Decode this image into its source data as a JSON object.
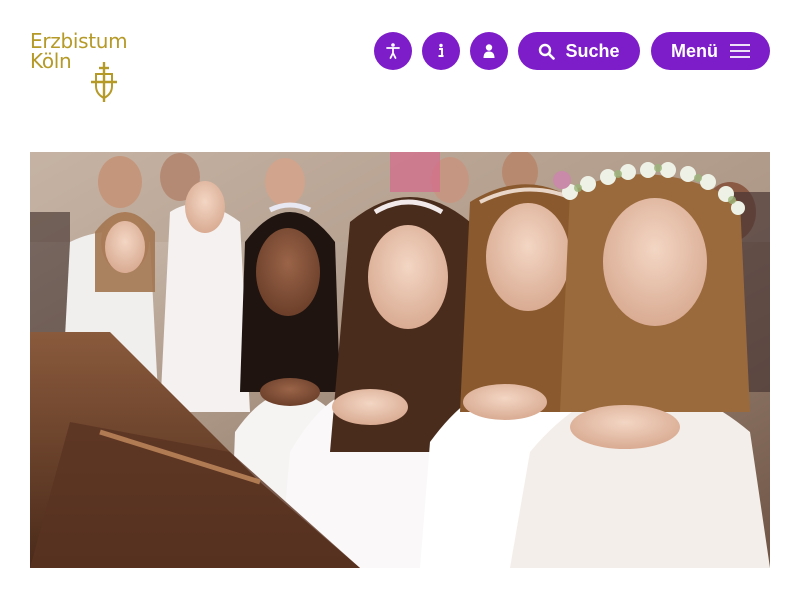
{
  "header": {
    "logo": {
      "line1": "Erzbistum",
      "line2": "Köln",
      "icon": "cross-shield-icon"
    },
    "actions": {
      "accessibility": {
        "icon": "accessibility-icon"
      },
      "info": {
        "icon": "info-icon"
      },
      "account": {
        "icon": "user-icon"
      },
      "search": {
        "label": "Suche",
        "icon": "search-icon"
      },
      "menu": {
        "label": "Menü",
        "icon": "hamburger-icon"
      }
    }
  },
  "hero": {
    "kind": "photo"
  },
  "colors": {
    "accent": "#7d1cc9",
    "brand_gold": "#b59a28"
  }
}
